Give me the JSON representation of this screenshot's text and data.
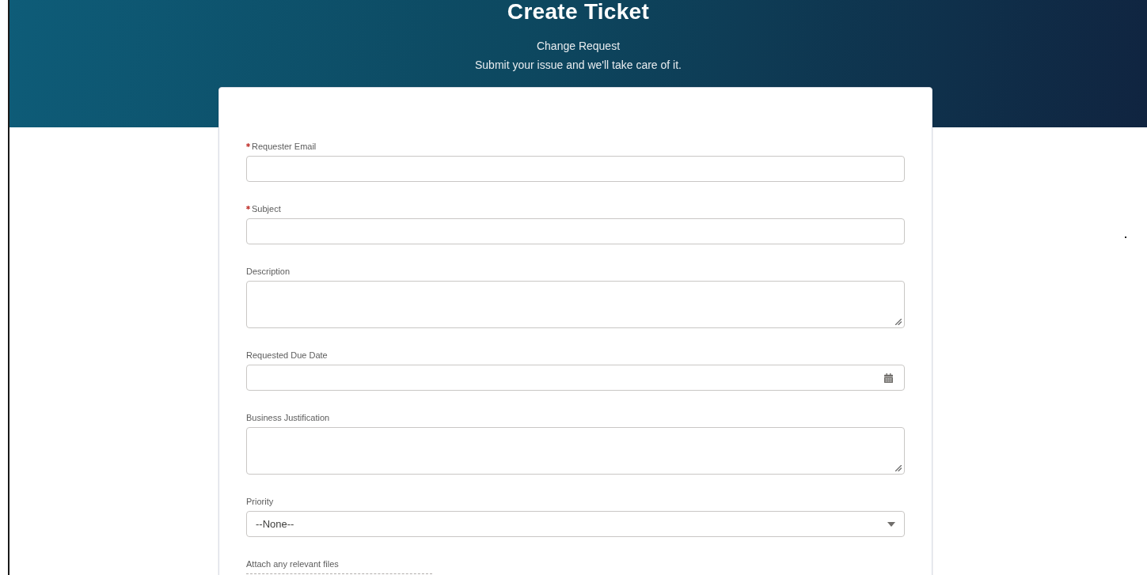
{
  "page": {
    "title": "Create Ticket",
    "subtitle": "Change Request",
    "tagline": "Submit your issue and we'll take care of it."
  },
  "form": {
    "fields": [
      {
        "kind": "text",
        "label": "Requester Email",
        "required": true
      },
      {
        "kind": "text",
        "label": "Subject",
        "required": true
      },
      {
        "kind": "textarea",
        "label": "Description",
        "required": false
      },
      {
        "kind": "date",
        "label": "Requested Due Date",
        "required": false
      },
      {
        "kind": "textarea",
        "label": "Business Justification",
        "required": false
      },
      {
        "kind": "select",
        "label": "Priority",
        "required": false,
        "value": "--None--"
      },
      {
        "kind": "file",
        "label": "Attach any relevant files",
        "required": false
      }
    ]
  }
}
